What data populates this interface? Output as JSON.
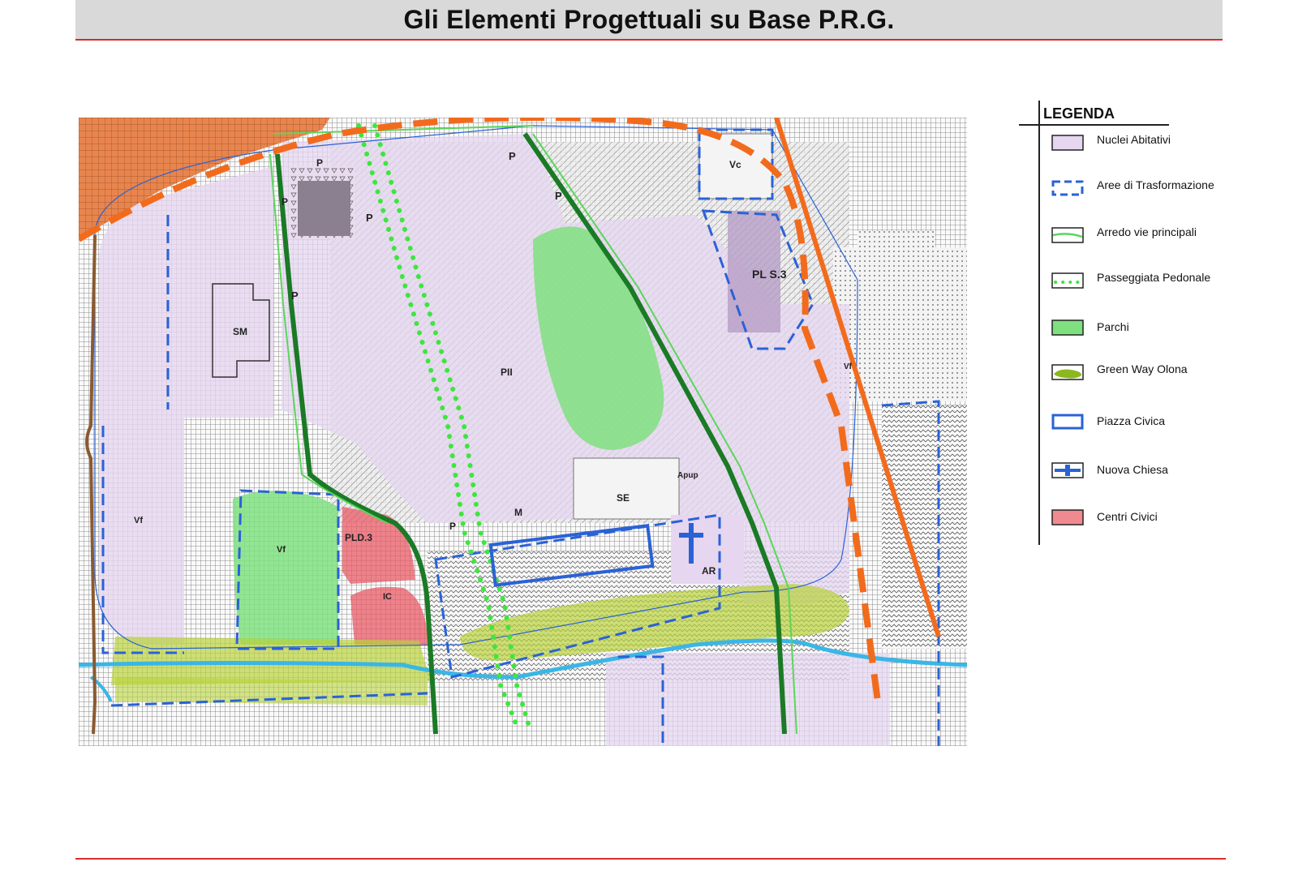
{
  "header": {
    "title": "Gli Elementi Progettuali su Base P.R.G."
  },
  "legend": {
    "title": "LEGENDA",
    "items": [
      {
        "key": "nuclei",
        "label": "Nuclei Abitativi",
        "icon": "lilac-filled-box"
      },
      {
        "key": "aree",
        "label": "Aree di Trasformazione",
        "icon": "blue-dashed-box"
      },
      {
        "key": "arredo",
        "label": "Arredo vie principali",
        "icon": "green-line"
      },
      {
        "key": "passeggiata",
        "label": "Passeggiata Pedonale",
        "icon": "green-dotted-line"
      },
      {
        "key": "parchi",
        "label": "Parchi",
        "icon": "green-filled-box"
      },
      {
        "key": "greenway",
        "label": "Green Way Olona",
        "icon": "olive-blob"
      },
      {
        "key": "piazza",
        "label": "Piazza Civica",
        "icon": "blue-outline-box"
      },
      {
        "key": "chiesa",
        "label": "Nuova Chiesa",
        "icon": "blue-cross"
      },
      {
        "key": "centri",
        "label": "Centri Civici",
        "icon": "red-filled-box"
      }
    ]
  },
  "map": {
    "zone_labels": [
      "Vc",
      "P",
      "P",
      "P",
      "P",
      "P",
      "P",
      "SM",
      "PII",
      "Vf",
      "Vf",
      "PLD.3",
      "IC",
      "SE",
      "M",
      "AR",
      "Apup",
      "P",
      "PL S.3",
      "Vf"
    ],
    "colors": {
      "nuclei": "#e6d6f0",
      "aree": "#2a62d6",
      "arredo": "#5bd65b",
      "arredo_dark": "#1a7a25",
      "passeggiata": "#3ee63e",
      "parchi": "#7fe07f",
      "greenway": "#b8d23a",
      "piazza": "#2a62d6",
      "centri": "#f07a84",
      "river": "#3ab6e6",
      "boundary": "#f26b1d",
      "historic": "#e6844c"
    }
  }
}
